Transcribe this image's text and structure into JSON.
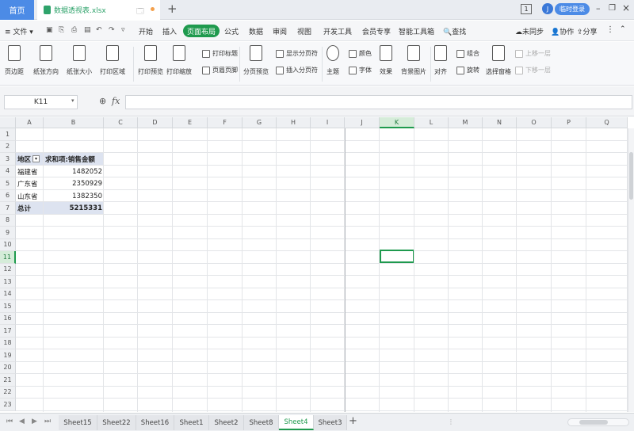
{
  "titlebar": {
    "home_tab": "首页",
    "doc_title": "数据透视表.xlsx",
    "login": "临时登录",
    "avatar_letter": "J",
    "win_count": "1"
  },
  "menu": {
    "file": "≡ 文件 ▾",
    "items": [
      "开始",
      "插入",
      "页面布局",
      "公式",
      "数据",
      "审阅",
      "视图",
      "开发工具",
      "会员专享",
      "智能工具箱"
    ],
    "active": "页面布局",
    "search": "🔍查找",
    "sync": "未同步",
    "collab": "协作",
    "share": "分享"
  },
  "ribbon": {
    "margins": "页边距",
    "orientation": "纸张方向",
    "size": "纸张大小",
    "print_area": "打印区域",
    "print_preview": "打印预览",
    "print_scale": "打印缩放",
    "print_titles": "打印标题",
    "header_footer": "页眉页脚",
    "page_break_preview": "分页预览",
    "show_page_breaks": "显示分页符",
    "insert_page_break": "插入分页符",
    "theme": "主题",
    "colors": "颜色",
    "fonts": "字体",
    "effects": "效果",
    "background": "背景图片",
    "align": "对齐",
    "group": "组合",
    "rotate": "旋转",
    "selection_pane": "选择窗格",
    "bring_forward": "上移一层",
    "send_backward": "下移一层"
  },
  "formula": {
    "namebox": "K11",
    "value": ""
  },
  "columns": [
    "A",
    "B",
    "C",
    "D",
    "E",
    "F",
    "G",
    "H",
    "I",
    "J",
    "K",
    "L",
    "M",
    "N",
    "O",
    "P",
    "Q"
  ],
  "rows": [
    "1",
    "2",
    "3",
    "4",
    "5",
    "6",
    "7",
    "8",
    "9",
    "10",
    "11",
    "12",
    "13",
    "14",
    "15",
    "16",
    "17",
    "18",
    "19",
    "20",
    "21",
    "22",
    "23"
  ],
  "selected": {
    "column": "K",
    "row": "11"
  },
  "pivot": {
    "header_region": "地区",
    "header_value": "求和项:销售金额",
    "rows": [
      {
        "region": "福建省",
        "amount": "1482052"
      },
      {
        "region": "广东省",
        "amount": "2350929"
      },
      {
        "region": "山东省",
        "amount": "1382350"
      }
    ],
    "total_label": "总计",
    "total_value": "5215331"
  },
  "sheets": [
    "Sheet15",
    "Sheet22",
    "Sheet16",
    "Sheet1",
    "Sheet2",
    "Sheet8",
    "Sheet4",
    "Sheet3"
  ],
  "active_sheet": "Sheet4",
  "colors": {
    "accent": "#1f9a4e",
    "brand_blue": "#4c8be6",
    "pivot_fill": "#dde3f0"
  }
}
